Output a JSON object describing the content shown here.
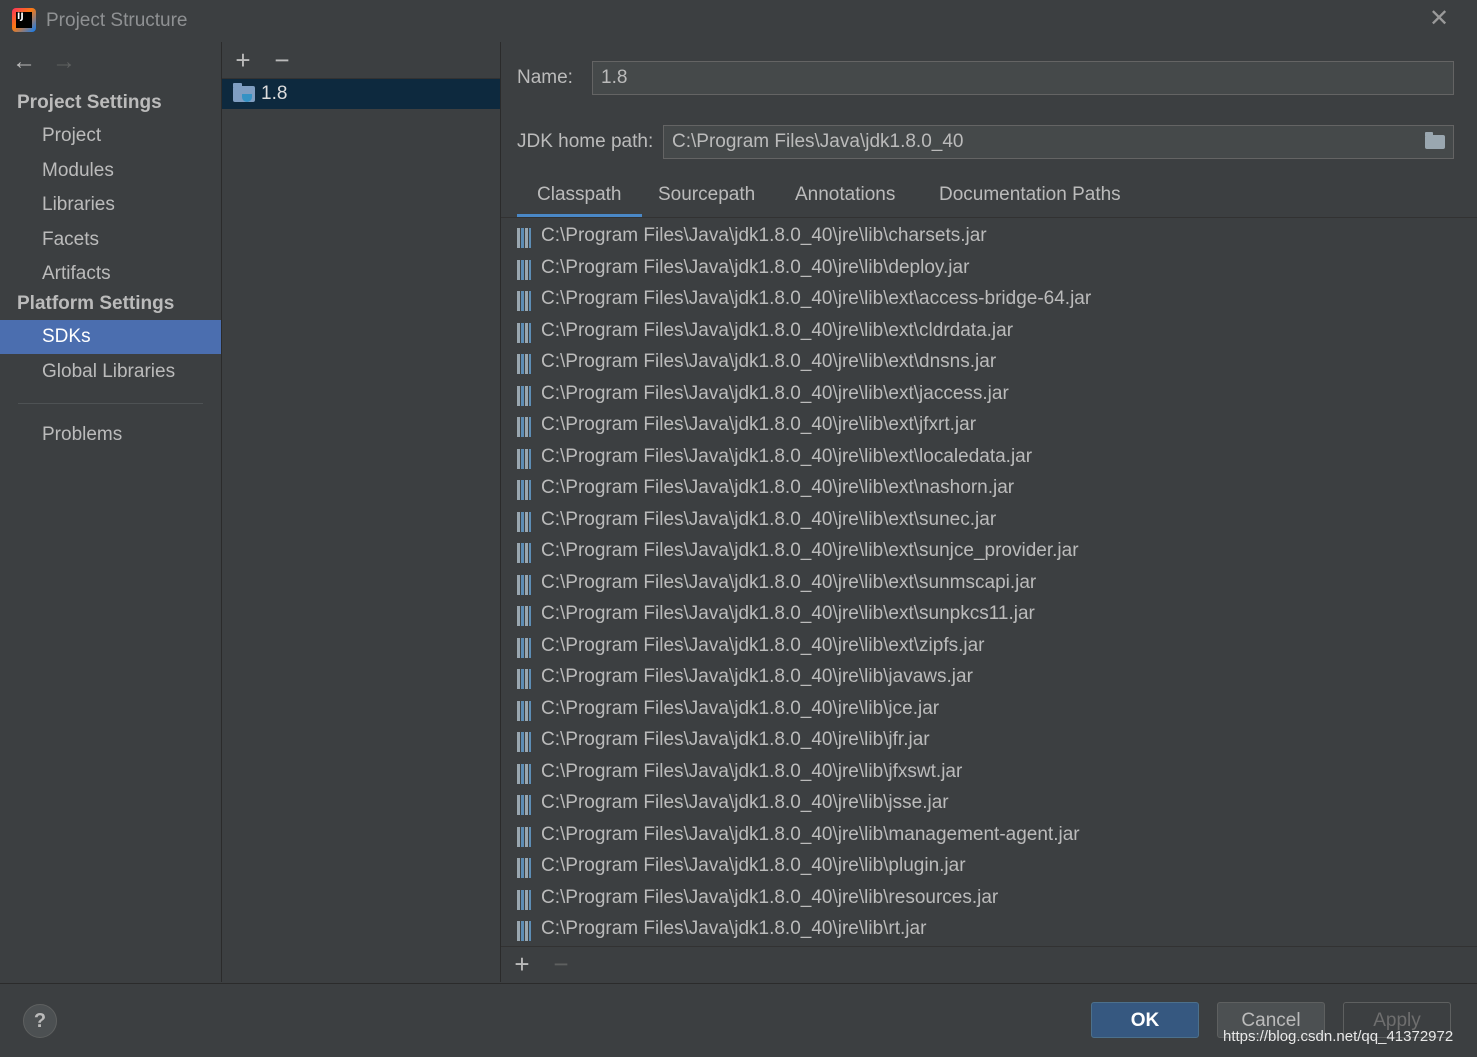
{
  "window": {
    "title": "Project Structure",
    "close_icon": "close-icon"
  },
  "nav": {
    "back": "←",
    "forward": "→"
  },
  "sidebar": {
    "project_settings_title": "Project Settings",
    "platform_settings_title": "Platform Settings",
    "items": [
      {
        "label": "Project"
      },
      {
        "label": "Modules"
      },
      {
        "label": "Libraries"
      },
      {
        "label": "Facets"
      },
      {
        "label": "Artifacts"
      },
      {
        "label": "SDKs",
        "selected": true
      },
      {
        "label": "Global Libraries"
      },
      {
        "label": "Problems"
      }
    ]
  },
  "middle": {
    "add_label": "+",
    "remove_label": "−",
    "sdk_items": [
      {
        "label": "1.8"
      }
    ]
  },
  "detail": {
    "name_label": "Name:",
    "name_value": "1.8",
    "jdk_label": "JDK home path:",
    "jdk_value": "C:\\Program Files\\Java\\jdk1.8.0_40",
    "tabs": [
      {
        "label": "Classpath",
        "active": true
      },
      {
        "label": "Sourcepath"
      },
      {
        "label": "Annotations"
      },
      {
        "label": "Documentation Paths"
      }
    ],
    "classpath": [
      "C:\\Program Files\\Java\\jdk1.8.0_40\\jre\\lib\\charsets.jar",
      "C:\\Program Files\\Java\\jdk1.8.0_40\\jre\\lib\\deploy.jar",
      "C:\\Program Files\\Java\\jdk1.8.0_40\\jre\\lib\\ext\\access-bridge-64.jar",
      "C:\\Program Files\\Java\\jdk1.8.0_40\\jre\\lib\\ext\\cldrdata.jar",
      "C:\\Program Files\\Java\\jdk1.8.0_40\\jre\\lib\\ext\\dnsns.jar",
      "C:\\Program Files\\Java\\jdk1.8.0_40\\jre\\lib\\ext\\jaccess.jar",
      "C:\\Program Files\\Java\\jdk1.8.0_40\\jre\\lib\\ext\\jfxrt.jar",
      "C:\\Program Files\\Java\\jdk1.8.0_40\\jre\\lib\\ext\\localedata.jar",
      "C:\\Program Files\\Java\\jdk1.8.0_40\\jre\\lib\\ext\\nashorn.jar",
      "C:\\Program Files\\Java\\jdk1.8.0_40\\jre\\lib\\ext\\sunec.jar",
      "C:\\Program Files\\Java\\jdk1.8.0_40\\jre\\lib\\ext\\sunjce_provider.jar",
      "C:\\Program Files\\Java\\jdk1.8.0_40\\jre\\lib\\ext\\sunmscapi.jar",
      "C:\\Program Files\\Java\\jdk1.8.0_40\\jre\\lib\\ext\\sunpkcs11.jar",
      "C:\\Program Files\\Java\\jdk1.8.0_40\\jre\\lib\\ext\\zipfs.jar",
      "C:\\Program Files\\Java\\jdk1.8.0_40\\jre\\lib\\javaws.jar",
      "C:\\Program Files\\Java\\jdk1.8.0_40\\jre\\lib\\jce.jar",
      "C:\\Program Files\\Java\\jdk1.8.0_40\\jre\\lib\\jfr.jar",
      "C:\\Program Files\\Java\\jdk1.8.0_40\\jre\\lib\\jfxswt.jar",
      "C:\\Program Files\\Java\\jdk1.8.0_40\\jre\\lib\\jsse.jar",
      "C:\\Program Files\\Java\\jdk1.8.0_40\\jre\\lib\\management-agent.jar",
      "C:\\Program Files\\Java\\jdk1.8.0_40\\jre\\lib\\plugin.jar",
      "C:\\Program Files\\Java\\jdk1.8.0_40\\jre\\lib\\resources.jar",
      "C:\\Program Files\\Java\\jdk1.8.0_40\\jre\\lib\\rt.jar"
    ],
    "list_add_label": "+",
    "list_remove_label": "−"
  },
  "footer": {
    "help_label": "?",
    "ok_label": "OK",
    "cancel_label": "Cancel",
    "apply_label": "Apply",
    "watermark": "https://blog.csdn.net/qq_41372972"
  },
  "colors": {
    "background": "#3c3f41",
    "selection": "#4b6eaf",
    "tree_selection": "#0d293e",
    "accent": "#4a88c7",
    "ok_button": "#365880"
  }
}
